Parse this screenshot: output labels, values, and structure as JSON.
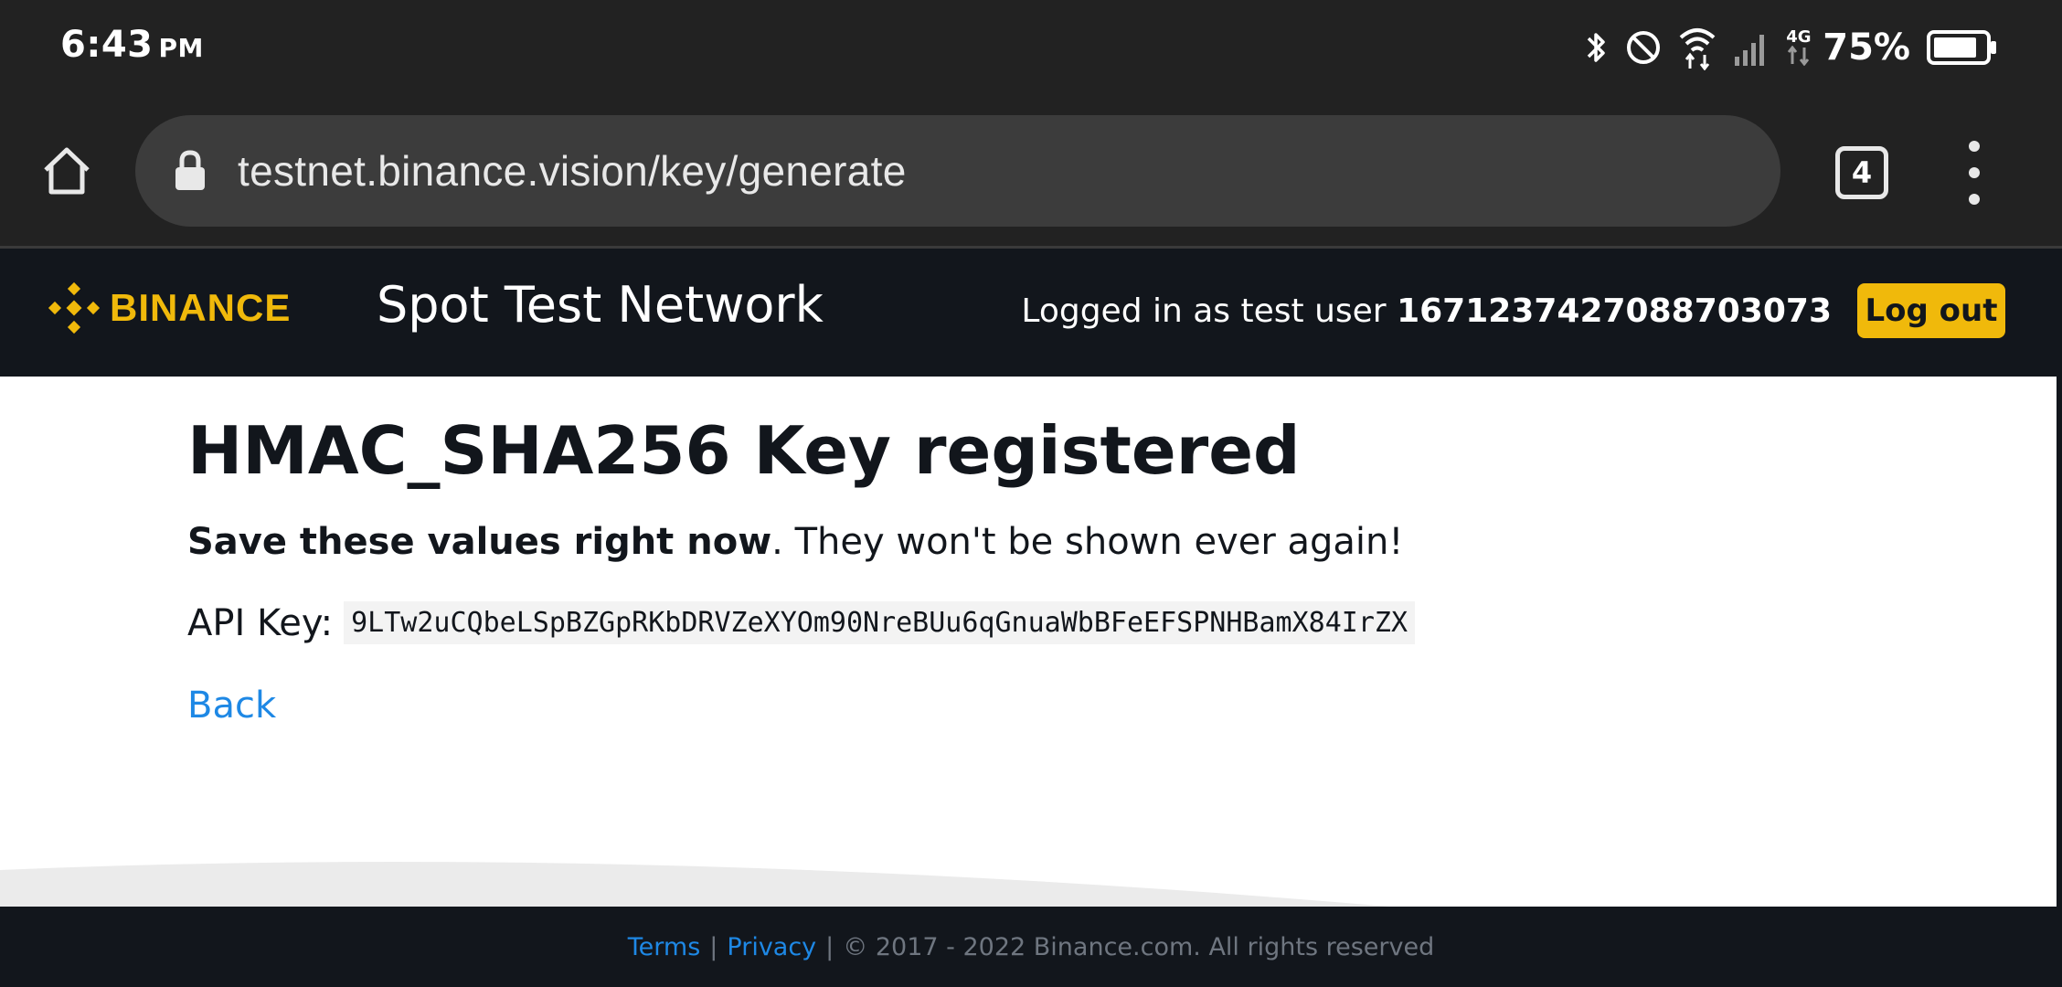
{
  "status_bar": {
    "time": "6:43",
    "ampm": "PM",
    "battery_percent": "75%",
    "network_label": "4G",
    "icons": [
      "bluetooth-icon",
      "do-not-disturb-icon",
      "wifi-icon",
      "signal-icon",
      "mobile-data-icon",
      "battery-icon"
    ]
  },
  "browser": {
    "url": "testnet.binance.vision/key/generate",
    "tab_count": "4"
  },
  "site_header": {
    "logo_text": "BINANCE",
    "title": "Spot Test Network",
    "logged_in_prefix": "Logged in as test user ",
    "user_id": "1671237427088703073",
    "logout_label": "Log out",
    "brand_color": "#f0b90b"
  },
  "main": {
    "heading": "HMAC_SHA256 Key registered",
    "warning_bold": "Save these values right now",
    "warning_rest": ". They won't be shown ever again!",
    "api_key_label": "API Key:",
    "api_key_value": "9LTw2uCQbeLSpBZGpRKbDRVZeXYOm90NreBUu6qGnuaWbBFeEFSPNHBamX84IrZX",
    "back_label": "Back"
  },
  "footer": {
    "terms_label": "Terms",
    "divider_1": "|",
    "privacy_label": "Privacy",
    "divider_2": "|",
    "copyright": "© 2017 - 2022 Binance.com. All rights reserved"
  }
}
